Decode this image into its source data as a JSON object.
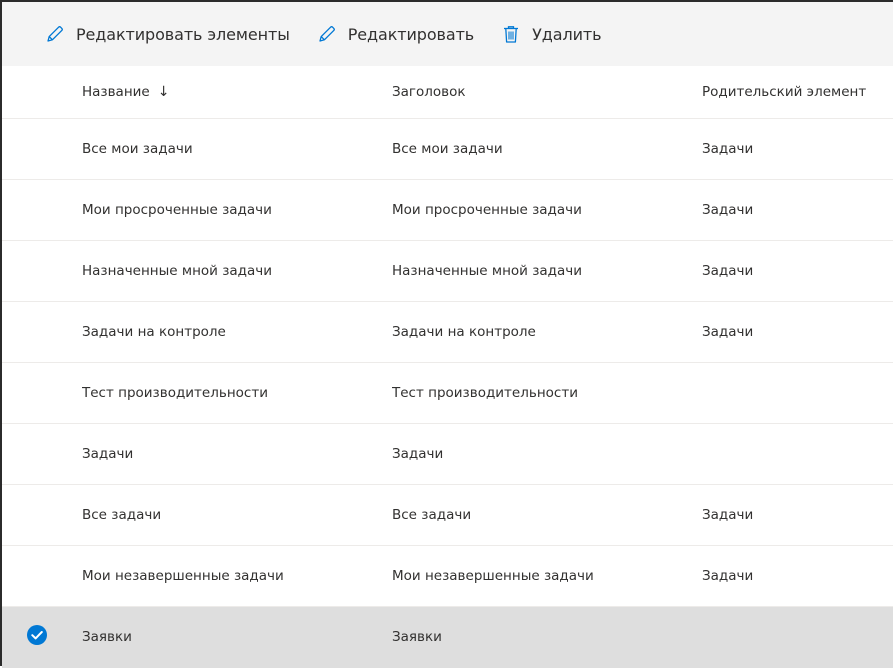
{
  "toolbar": {
    "edit_items_label": "Редактировать элементы",
    "edit_label": "Редактировать",
    "delete_label": "Удалить"
  },
  "columns": {
    "name": "Название",
    "name_sort_indicator": "↓",
    "title": "Заголовок",
    "parent": "Родительский элемент"
  },
  "rows": [
    {
      "name": "Все мои задачи",
      "title": "Все мои задачи",
      "parent": "Задачи",
      "selected": false
    },
    {
      "name": "Мои просроченные задачи",
      "title": "Мои просроченные задачи",
      "parent": "Задачи",
      "selected": false
    },
    {
      "name": "Назначенные мной задачи",
      "title": "Назначенные мной задачи",
      "parent": "Задачи",
      "selected": false
    },
    {
      "name": "Задачи на контроле",
      "title": "Задачи на контроле",
      "parent": "Задачи",
      "selected": false
    },
    {
      "name": "Тест производительности",
      "title": "Тест производительности",
      "parent": "",
      "selected": false
    },
    {
      "name": "Задачи",
      "title": "Задачи",
      "parent": "",
      "selected": false
    },
    {
      "name": "Все задачи",
      "title": "Все задачи",
      "parent": "Задачи",
      "selected": false
    },
    {
      "name": "Мои незавершенные задачи",
      "title": "Мои незавершенные задачи",
      "parent": "Задачи",
      "selected": false
    },
    {
      "name": "Заявки",
      "title": "Заявки",
      "parent": "",
      "selected": true
    }
  ],
  "colors": {
    "accent": "#0078d4",
    "selected_row": "#dedede",
    "toolbar_bg": "#f4f4f4"
  },
  "icons": {
    "edit_items": "pencil-icon",
    "edit": "pencil-icon",
    "delete": "trash-icon",
    "selected": "checkmark-circle-icon"
  }
}
